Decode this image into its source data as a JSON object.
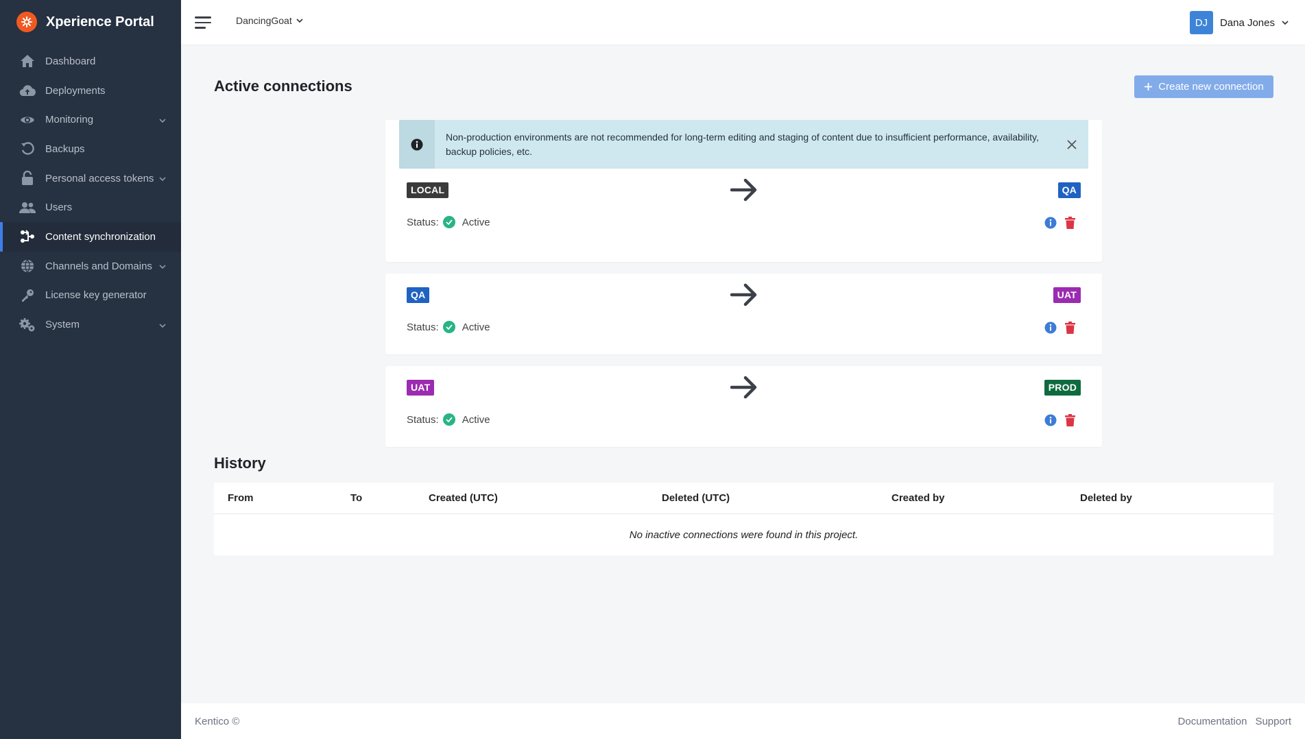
{
  "app": {
    "title": "Xperience Portal"
  },
  "sidebar": {
    "items": [
      {
        "label": "Dashboard",
        "icon": "home-icon",
        "chevron": false,
        "active": false
      },
      {
        "label": "Deployments",
        "icon": "cloud-upload-icon",
        "chevron": false,
        "active": false
      },
      {
        "label": "Monitoring",
        "icon": "eye-icon",
        "chevron": true,
        "active": false
      },
      {
        "label": "Backups",
        "icon": "history-icon",
        "chevron": false,
        "active": false
      },
      {
        "label": "Personal access tokens",
        "icon": "lock-icon",
        "chevron": true,
        "active": false
      },
      {
        "label": "Users",
        "icon": "users-icon",
        "chevron": false,
        "active": false
      },
      {
        "label": "Content synchronization",
        "icon": "sync-icon",
        "chevron": false,
        "active": true
      },
      {
        "label": "Channels and Domains",
        "icon": "globe-icon",
        "chevron": true,
        "active": false
      },
      {
        "label": "License key generator",
        "icon": "key-icon",
        "chevron": false,
        "active": false
      },
      {
        "label": "System",
        "icon": "cogs-icon",
        "chevron": true,
        "active": false
      }
    ]
  },
  "header": {
    "project": "DancingGoat",
    "user": {
      "initials": "DJ",
      "name": "Dana Jones"
    }
  },
  "connections_section": {
    "title": "Active connections",
    "create_label": "Create new connection",
    "alert": "Non-production environments are not recommended for long-term editing and staging of content due to insufficient performance, availability, backup policies, etc.",
    "status_label": "Status:",
    "connections": [
      {
        "from": "LOCAL",
        "from_color": "#3a3a3a",
        "to": "QA",
        "to_color": "#1f62c2",
        "status": "Active"
      },
      {
        "from": "QA",
        "from_color": "#1f62c2",
        "to": "UAT",
        "to_color": "#9b2bb0",
        "status": "Active"
      },
      {
        "from": "UAT",
        "from_color": "#9b2bb0",
        "to": "PROD",
        "to_color": "#0f6b3f",
        "status": "Active"
      }
    ]
  },
  "history": {
    "title": "History",
    "columns": [
      "From",
      "To",
      "Created (UTC)",
      "Deleted (UTC)",
      "Created by",
      "Deleted by"
    ],
    "empty_message": "No inactive connections were found in this project."
  },
  "footer": {
    "copyright": "Kentico ©",
    "links": [
      "Documentation",
      "Support"
    ]
  },
  "colors": {
    "sidebar_bg": "#263142",
    "accent": "#3f7ee8",
    "create_button": "#82abea",
    "alert_bg": "#cfe7ee",
    "status_active": "#28b485",
    "delete": "#dc3545",
    "info": "#3d7bd6"
  }
}
